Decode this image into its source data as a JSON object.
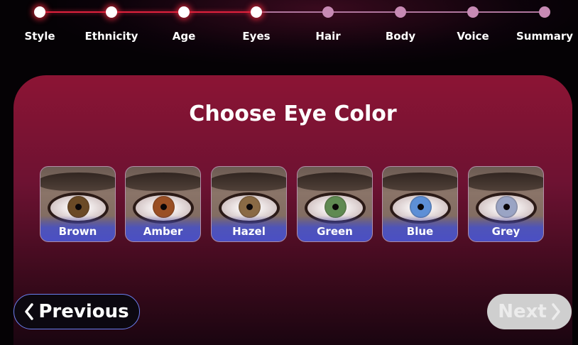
{
  "stepper": {
    "steps": [
      {
        "label": "Style",
        "state": "done"
      },
      {
        "label": "Ethnicity",
        "state": "done"
      },
      {
        "label": "Age",
        "state": "done"
      },
      {
        "label": "Eyes",
        "state": "current"
      },
      {
        "label": "Hair",
        "state": "todo"
      },
      {
        "label": "Body",
        "state": "todo"
      },
      {
        "label": "Voice",
        "state": "todo"
      },
      {
        "label": "Summary",
        "state": "todo"
      }
    ]
  },
  "main": {
    "title": "Choose Eye Color",
    "options": [
      {
        "label": "Brown",
        "iris_color": "#6b4a26"
      },
      {
        "label": "Amber",
        "iris_color": "#9a4f24"
      },
      {
        "label": "Hazel",
        "iris_color": "#8a6a45"
      },
      {
        "label": "Green",
        "iris_color": "#5f8a52"
      },
      {
        "label": "Blue",
        "iris_color": "#5d8fd6"
      },
      {
        "label": "Grey",
        "iris_color": "#9aa4c4"
      }
    ]
  },
  "nav": {
    "previous_label": "Previous",
    "next_label": "Next",
    "next_enabled": false
  },
  "colors": {
    "accent": "#e0213d",
    "card_top": "#8c1434",
    "option_label_bg": "#4b4fc4",
    "prev_border": "#6a7ff0",
    "next_disabled_bg": "#cfcfcf"
  }
}
